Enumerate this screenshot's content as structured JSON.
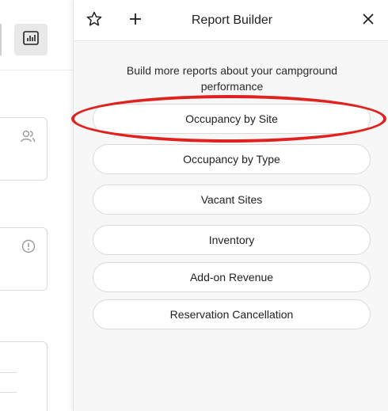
{
  "background": {
    "chart_button_icon": "bar-chart-icon",
    "card_icons": [
      "users-icon",
      "info-circle-icon"
    ]
  },
  "panel": {
    "title": "Report Builder",
    "star_icon": "star-icon",
    "plus_icon": "plus-icon",
    "close_icon": "close-icon",
    "intro": "Build more reports about your campground performance",
    "reports": [
      {
        "label": "Occupancy by Site"
      },
      {
        "label": "Occupancy by Type"
      },
      {
        "label": "Vacant Sites"
      },
      {
        "label": "Inventory"
      },
      {
        "label": "Add-on Revenue"
      },
      {
        "label": "Reservation Cancellation"
      }
    ]
  },
  "annotation": {
    "color": "#e0221f",
    "target": "Occupancy by Site"
  }
}
